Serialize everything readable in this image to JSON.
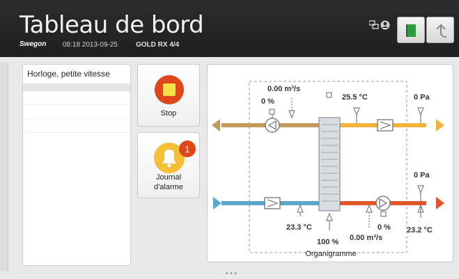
{
  "header": {
    "title": "Tableau de bord",
    "brand": "Swegon",
    "time_date": "08:18 2013-09-25",
    "model": "GOLD RX  4/4"
  },
  "icons": {
    "network": "network-icon",
    "user": "user-icon",
    "exit": "exit-door-icon",
    "back": "back-arrow-icon"
  },
  "alarm_panel": {
    "first_item": "Horloge, petite vitesse"
  },
  "tiles": {
    "stop_label": "Stop",
    "alarm_label_line1": "Journal",
    "alarm_label_line2": "d'alarme",
    "alarm_badge": "1"
  },
  "diagram": {
    "supply_flow": "0.00 m³/s",
    "supply_fan_pct": "0 %",
    "extract_temp": "25.5 °C",
    "extract_pressure": "0 Pa",
    "outdoor_pressure": "0 Pa",
    "outdoor_temp": "23.3 °C",
    "exchanger_pct": "100 %",
    "exhaust_fan_pct": "0 %",
    "exhaust_flow": "0.00 m³/s",
    "supply_temp": "23.2 °C",
    "label": "Organigramme"
  },
  "pager": "•••",
  "colors": {
    "extract_warm": "#f0b43c",
    "extract_brown": "#c49a5c",
    "supply_blue": "#59a7cc",
    "supply_red": "#e0572a",
    "stop_orange": "#e0461c",
    "alarm_yellow": "#f5c035"
  }
}
